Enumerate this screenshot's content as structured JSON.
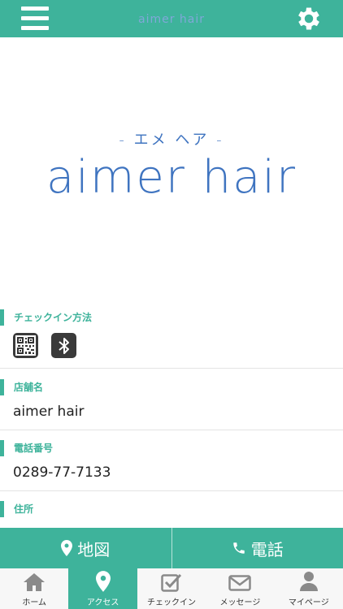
{
  "header": {
    "title": "aimer hair",
    "menu_icon": "hamburger-menu-icon",
    "settings_icon": "gear-icon"
  },
  "hero": {
    "logo_sub": "- エメ ヘア -",
    "logo_main": "aimer  hair"
  },
  "sections": {
    "checkin_method": {
      "label": "チェックイン方法",
      "icons": [
        "qr-code-icon",
        "bluetooth-icon"
      ]
    },
    "store_name": {
      "label": "店舗名",
      "value": "aimer hair"
    },
    "phone": {
      "label": "電話番号",
      "value": "0289-77-7133"
    },
    "address": {
      "label": "住所"
    }
  },
  "actions": {
    "map_label": "地図",
    "call_label": "電話"
  },
  "tabs": [
    {
      "label": "ホーム",
      "icon": "home-icon"
    },
    {
      "label": "アクセス",
      "icon": "map-pin-icon"
    },
    {
      "label": "チェックイン",
      "icon": "checkbox-icon"
    },
    {
      "label": "メッセージ",
      "icon": "envelope-icon"
    },
    {
      "label": "マイページ",
      "icon": "user-icon"
    }
  ],
  "colors": {
    "accent": "#3eb39b",
    "logo_blue": "#3f74c0",
    "text": "#222222",
    "tab_bg": "#f7f7f7"
  }
}
